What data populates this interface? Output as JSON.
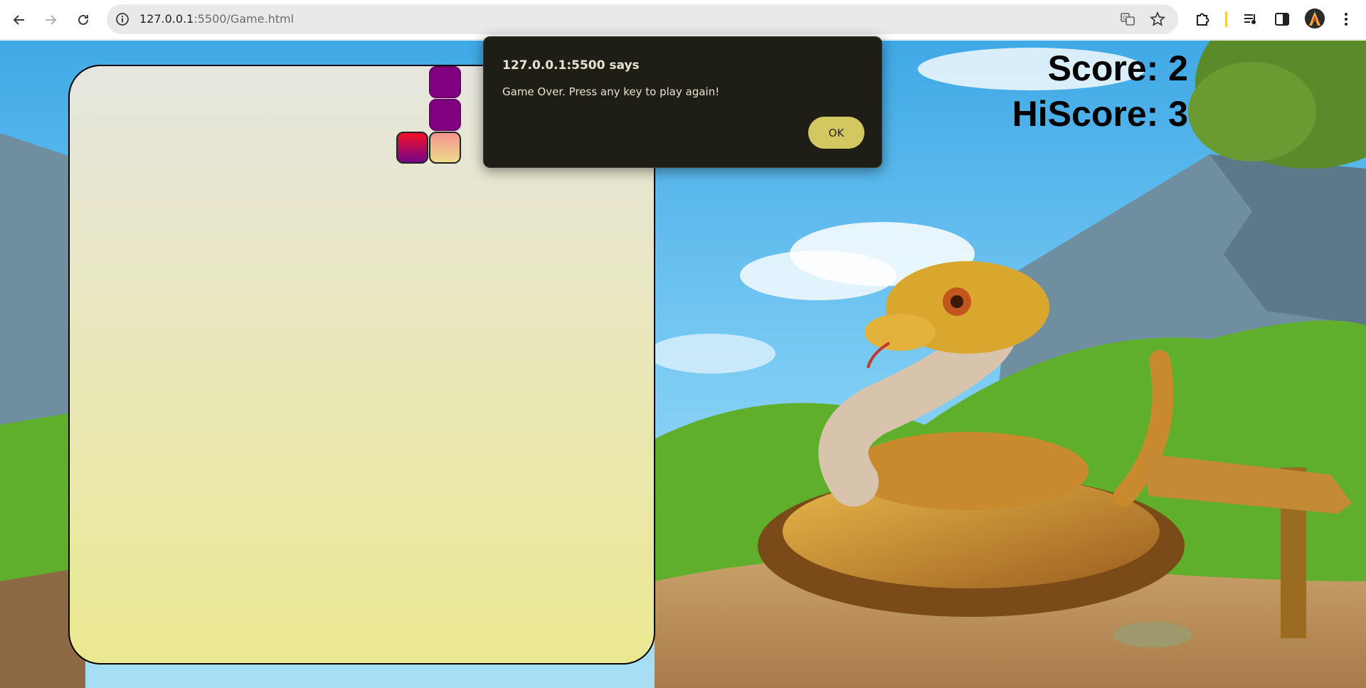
{
  "browser": {
    "url_host": "127.0.0.1",
    "url_rest": ":5500/Game.html",
    "icons": {
      "back": "arrow-left-icon",
      "forward": "arrow-right-icon",
      "reload": "reload-icon",
      "info": "info-icon",
      "translate": "translate-icon",
      "bookmark": "star-icon",
      "extensions": "puzzle-icon",
      "media": "media-control-icon",
      "side_panel": "side-panel-icon",
      "profile": "avatar",
      "menu": "kebab-menu-icon"
    }
  },
  "game": {
    "score_label": "Score: 2",
    "hiscore_label": "HiScore: 3",
    "colors": {
      "board_top": "#e6e6df",
      "board_bottom": "#ebe891",
      "snake_body": "#800080",
      "snake_head_top": "#f5928f",
      "snake_head_bottom": "#eddc8b",
      "food_top": "#f50f27",
      "food_bottom": "#760688"
    }
  },
  "dialog": {
    "title": "127.0.0.1:5500 says",
    "message": "Game Over. Press any key to play again!",
    "ok_label": "OK"
  }
}
